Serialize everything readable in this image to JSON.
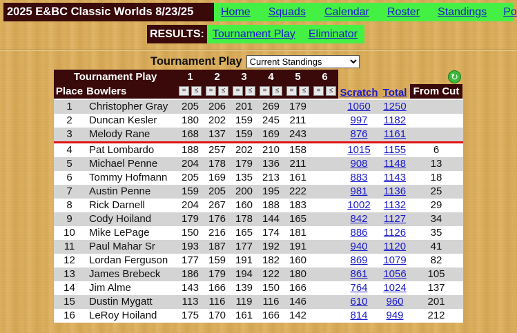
{
  "header": {
    "title": "2025 E&BC Classic Worlds 8/23/25",
    "nav": [
      "Home",
      "Squads",
      "Calendar",
      "Roster",
      "Standings",
      "Pots"
    ]
  },
  "results": {
    "label": "RESULTS:",
    "links": [
      "Tournament Play",
      "Eliminator"
    ]
  },
  "view": {
    "label": "Tournament Play",
    "selected": "Current Standings"
  },
  "table": {
    "group_title": "Tournament Play",
    "games": [
      "1",
      "2",
      "3",
      "4",
      "5",
      "6"
    ],
    "col_place": "Place",
    "col_bowlers": "Bowlers",
    "col_scratch": "Scratch",
    "col_total": "Total",
    "col_cut": "From Cut",
    "sort_up": "=",
    "sort_down": "≤",
    "rows": [
      {
        "place": "1",
        "name": "Christopher Gray",
        "g": [
          "205",
          "206",
          "201",
          "269",
          "179",
          ""
        ],
        "scratch": "1060",
        "total": "1250",
        "cut": ""
      },
      {
        "place": "2",
        "name": "Duncan Kesler",
        "g": [
          "180",
          "202",
          "159",
          "245",
          "211",
          ""
        ],
        "scratch": "997",
        "total": "1182",
        "cut": ""
      },
      {
        "place": "3",
        "name": "Melody Rane",
        "g": [
          "168",
          "137",
          "159",
          "169",
          "243",
          ""
        ],
        "scratch": "876",
        "total": "1161",
        "cut": ""
      },
      {
        "place": "4",
        "name": "Pat Lombardo",
        "g": [
          "188",
          "257",
          "202",
          "210",
          "158",
          ""
        ],
        "scratch": "1015",
        "total": "1155",
        "cut": "6"
      },
      {
        "place": "5",
        "name": "Michael Penne",
        "g": [
          "204",
          "178",
          "179",
          "136",
          "211",
          ""
        ],
        "scratch": "908",
        "total": "1148",
        "cut": "13"
      },
      {
        "place": "6",
        "name": "Tommy Hofmann",
        "g": [
          "205",
          "169",
          "135",
          "213",
          "161",
          ""
        ],
        "scratch": "883",
        "total": "1143",
        "cut": "18"
      },
      {
        "place": "7",
        "name": "Austin Penne",
        "g": [
          "159",
          "205",
          "200",
          "195",
          "222",
          ""
        ],
        "scratch": "981",
        "total": "1136",
        "cut": "25"
      },
      {
        "place": "8",
        "name": "Rick Darnell",
        "g": [
          "204",
          "267",
          "160",
          "188",
          "183",
          ""
        ],
        "scratch": "1002",
        "total": "1132",
        "cut": "29"
      },
      {
        "place": "9",
        "name": "Cody Hoiland",
        "g": [
          "179",
          "176",
          "178",
          "144",
          "165",
          ""
        ],
        "scratch": "842",
        "total": "1127",
        "cut": "34"
      },
      {
        "place": "10",
        "name": "Mike LePage",
        "g": [
          "150",
          "216",
          "165",
          "174",
          "181",
          ""
        ],
        "scratch": "886",
        "total": "1126",
        "cut": "35"
      },
      {
        "place": "11",
        "name": "Paul Mahar Sr",
        "g": [
          "193",
          "187",
          "177",
          "192",
          "191",
          ""
        ],
        "scratch": "940",
        "total": "1120",
        "cut": "41"
      },
      {
        "place": "12",
        "name": "Lordan Ferguson",
        "g": [
          "177",
          "159",
          "191",
          "182",
          "160",
          ""
        ],
        "scratch": "869",
        "total": "1079",
        "cut": "82"
      },
      {
        "place": "13",
        "name": "James Brebeck",
        "g": [
          "186",
          "179",
          "194",
          "122",
          "180",
          ""
        ],
        "scratch": "861",
        "total": "1056",
        "cut": "105"
      },
      {
        "place": "14",
        "name": "Jim Alme",
        "g": [
          "143",
          "166",
          "139",
          "150",
          "166",
          ""
        ],
        "scratch": "764",
        "total": "1024",
        "cut": "137"
      },
      {
        "place": "15",
        "name": "Dustin Mygatt",
        "g": [
          "113",
          "116",
          "119",
          "116",
          "146",
          ""
        ],
        "scratch": "610",
        "total": "960",
        "cut": "201"
      },
      {
        "place": "16",
        "name": "LeRoy Hoiland",
        "g": [
          "175",
          "170",
          "161",
          "166",
          "142",
          ""
        ],
        "scratch": "814",
        "total": "949",
        "cut": "212"
      }
    ]
  },
  "icons": {
    "refresh": "refresh-icon"
  }
}
